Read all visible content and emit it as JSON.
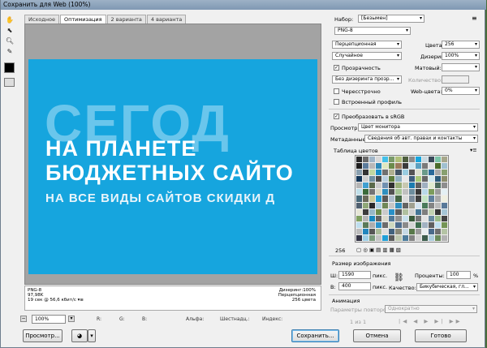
{
  "window": {
    "title": "Сохранить для Web (100%)"
  },
  "tabs": [
    "Исходное",
    "Оптимизация",
    "2 варианта",
    "4 варианта"
  ],
  "banner": {
    "bg_word": "СЕГОД",
    "line1": "НА ПЛАНЕТЕ",
    "line2": "БЮДЖЕТНЫХ САЙТО",
    "line3": "НА ВСЕ ВИДЫ САЙТОВ СКИДКИ Д",
    "bg_color": "#16a5de"
  },
  "info": {
    "format": "PNG-8",
    "size": "97,98K",
    "time": "19 сек @ 56,6 кбит/с",
    "menu": "▾≡",
    "dither": "Дизеринг:100%",
    "palette": "Перцепционная",
    "colors": "256 цвета"
  },
  "statusbar": {
    "zoom": "100%",
    "r": "R:",
    "g": "G:",
    "b": "B:",
    "alpha": "Альфа:",
    "hex": "Шестнадц.:",
    "index": "Индекс:"
  },
  "buttons": {
    "preview": "Просмотр...",
    "save": "Сохранить...",
    "cancel": "Отмена",
    "done": "Готово"
  },
  "settings": {
    "preset_label": "Набор:",
    "preset_value": "[Безымен]",
    "format_value": "PNG-8",
    "reduction": "Перцепционная",
    "colors_label": "Цвета:",
    "colors_value": "256",
    "dither_algo": "Случайное",
    "dither_label": "Дизеринг:",
    "dither_value": "100%",
    "transparency_label": "Прозрачность",
    "matte_label": "Матовый:",
    "transparency_dither": "Без дизеринга прозр...",
    "amount_label": "Количество:",
    "interlaced_label": "Чересстрочно",
    "websnap_label": "Web-цвета:",
    "websnap_value": "0%",
    "embed_profile_label": "Встроенный профиль",
    "convert_srgb_label": "Преобразовать в sRGB",
    "preview_label": "Просмотр:",
    "preview_value": "Цвет монитора",
    "metadata_label": "Метаданные:",
    "metadata_value": "Сведения об авт. правах и контакты",
    "color_table_label": "Таблица цветов",
    "color_count": "256",
    "image_size_label": "Размер изображения",
    "w_label": "Ш:",
    "w_value": "1590",
    "h_label": "В:",
    "h_value": "400",
    "px": "пикс.",
    "percent_label": "Проценты:",
    "percent_value": "100",
    "percent_sign": "%",
    "quality_label": "Качество:",
    "quality_value": "Бикубическая, гл...",
    "animation_label": "Анимация",
    "loop_label": "Параметры повторов:",
    "loop_value": "Однократно",
    "frame_counter": "1 из 1"
  },
  "palette_colors": [
    "#2b2b2b",
    "#6a6a6a",
    "#9fb5c8",
    "#d9d9d9",
    "#43c0e8",
    "#7a9a6a",
    "#b0c07a",
    "#4e5e3e",
    "#8b8b8b",
    "#16a5de",
    "#c9d9e0",
    "#3a4a5a",
    "#7bc4a8",
    "#a7a78b",
    "#1e1e1e",
    "#5c7c9c",
    "#b8b8b8",
    "#2e8ab8",
    "#dfe8c0",
    "#6b8b4b",
    "#9c7c5c",
    "#3b3b3b",
    "#cce6f0",
    "#5aa0c0",
    "#7a7a7a",
    "#e0e0e0",
    "#4b6b2b",
    "#a0c0d0",
    "#8aa0b0",
    "#333333",
    "#c0d8a0",
    "#1a90c8",
    "#707070",
    "#b0b090",
    "#445566",
    "#99cce0",
    "#555555",
    "#dde0d0",
    "#6a9a8a",
    "#2a6a9a",
    "#aaaaaa",
    "#88a070",
    "#123456",
    "#cfcfcf",
    "#7090a0",
    "#4a4a4a",
    "#bcd0e0",
    "#5d7d3d",
    "#90b0c0",
    "#e8e8e8",
    "#3d5d7d",
    "#a8c878",
    "#666666",
    "#d0e8f0",
    "#2b5b7b",
    "#8c8c6c",
    "#b5b5b5",
    "#40a0d0",
    "#5a6a4a",
    "#cccccc",
    "#7090b0",
    "#303030",
    "#9ab07a",
    "#c8c8b0",
    "#1c7cb0",
    "#606060",
    "#a0b0c0",
    "#e0ecd0",
    "#4c6c5c",
    "#8e8e8e",
    "#bfdfe9",
    "#3a6a3a",
    "#747474",
    "#d8d8c8",
    "#2f8fbf",
    "#525252",
    "#a4c494",
    "#c0c0c0",
    "#6d8d9d",
    "#383838",
    "#b8d8e8",
    "#7c9c5c",
    "#9d9d9d",
    "#e4f0f4",
    "#486878",
    "#6a6a5a",
    "#caca9a",
    "#24a0d8",
    "#585858",
    "#adbdcd",
    "#446644",
    "#dcdcdc",
    "#7a8a9a",
    "#3e3e3e",
    "#c4e4c4",
    "#60809c",
    "#a8a8a8",
    "#efefe0",
    "#506070",
    "#90a878",
    "#2a2a2a",
    "#b2d2e2",
    "#708858",
    "#c6c6c6",
    "#3090c0",
    "#646464",
    "#a0a090",
    "#d4e4f0",
    "#4a7a5a",
    "#848484",
    "#bbbbbb",
    "#587898",
    "#e6e6d6",
    "#3c3c3c",
    "#98b8c8",
    "#6e8e4e",
    "#cacaca",
    "#2890c8",
    "#5e5e5e",
    "#b0c0a0",
    "#d0d0d0",
    "#467696",
    "#7e7e7e",
    "#c2d2b2",
    "#363636",
    "#a6c6d6",
    "#80a060",
    "#b6b6b6",
    "#1888c0",
    "#626262",
    "#dadacc",
    "#507898",
    "#929292",
    "#c8e0ec",
    "#3a5a3a",
    "#767676",
    "#e2e2e2",
    "#688aa0",
    "#9cbc8c",
    "#444444",
    "#bedeee",
    "#5a7a5a",
    "#aeaeae",
    "#2c94cc",
    "#6c6c6c",
    "#cfd9bf",
    "#4e6e8e",
    "#8a8a8a",
    "#d6d6d6",
    "#3e6e4e",
    "#a2b2c2",
    "#5f5f5f",
    "#c0e0f0",
    "#749454",
    "#bcbcbc",
    "#2286be",
    "#565656",
    "#aabb99",
    "#dedede",
    "#42627e",
    "#888878",
    "#c6dae6",
    "#58784a",
    "#9a9a9a",
    "#e8eef0",
    "#4a6a8a",
    "#6e6e6e",
    "#b4c4a4",
    "#333344",
    "#9fcfe6",
    "#7a9a7a",
    "#c4c4c4",
    "#1f9fd7",
    "#5b5b5b",
    "#bfc9b0",
    "#4c7c9c",
    "#828282",
    "#d2d2d2",
    "#3c5c4c",
    "#acccdc",
    "#6a8a5a",
    "#b2b2b2",
    "#2a8ac0",
    "#646474",
    "#d8e8d8",
    "#567a9a",
    "#8f8f8f",
    "#cce4ee",
    "#46664a",
    "#7c7c7c",
    "#e0e0d0",
    "#6a8aa6",
    "#98b888",
    "#484848",
    "#b8e0f0",
    "#5e7e5e",
    "#a4a4a4",
    "#2e96ce",
    "#696969",
    "#c8d4b8",
    "#506e8c",
    "#868686",
    "#dadada",
    "#406a50",
    "#a8bccc",
    "#626262",
    "#c4e2f2",
    "#7a9a5a",
    "#bababa",
    "#2484c0",
    "#5a5a5a",
    "#b0c0a8",
    "#e4e4e4",
    "#46668a",
    "#8c8c7c",
    "#cadeea",
    "#5c7c4c",
    "#9e9e9e",
    "#eaf2f4",
    "#4c6c8c",
    "#727272",
    "#b8c8a8",
    "#3a3a4a",
    "#a2d2e8",
    "#7e9e7e",
    "#c8c8c8",
    "#20a2da",
    "#5d5d5d",
    "#c2ccb4",
    "#4e7ea0",
    "#848484",
    "#d4d4d4",
    "#3e5e4e",
    "#b0d0e0",
    "#6e8e5e",
    "#b4b4b4",
    "#2c8cc2"
  ]
}
